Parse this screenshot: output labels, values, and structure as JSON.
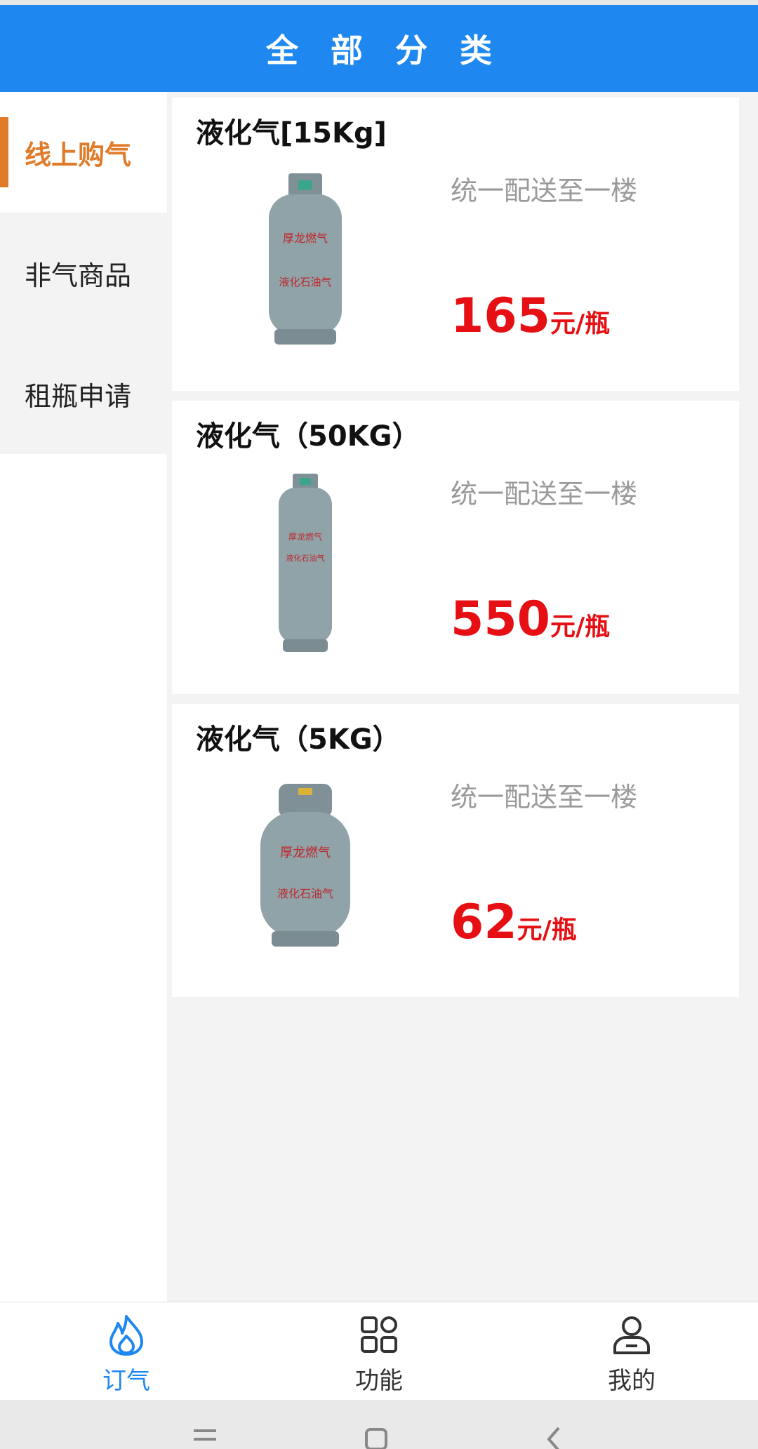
{
  "header": {
    "title": "全部分类"
  },
  "sidebar": {
    "items": [
      {
        "label": "线上购气",
        "active": true
      },
      {
        "label": "非气商品",
        "active": false
      },
      {
        "label": "租瓶申请",
        "active": false
      }
    ]
  },
  "products": [
    {
      "name": "液化气[15Kg]",
      "note": "统一配送至一楼",
      "price": "165",
      "unit": "元/瓶",
      "image": "gas-cylinder-15kg"
    },
    {
      "name": "液化气（50KG）",
      "note": "统一配送至一楼",
      "price": "550",
      "unit": "元/瓶",
      "image": "gas-cylinder-50kg"
    },
    {
      "name": "液化气（5KG）",
      "note": "统一配送至一楼",
      "price": "62",
      "unit": "元/瓶",
      "image": "gas-cylinder-5kg"
    }
  ],
  "tabbar": {
    "items": [
      {
        "label": "订气",
        "icon": "flame-icon",
        "active": true
      },
      {
        "label": "功能",
        "icon": "grid-icon",
        "active": false
      },
      {
        "label": "我的",
        "icon": "user-icon",
        "active": false
      }
    ]
  },
  "colors": {
    "header": "#1e87f0",
    "active_sidebar": "#e07b2a",
    "price": "#e60f14",
    "active_tab": "#1e87f0"
  }
}
